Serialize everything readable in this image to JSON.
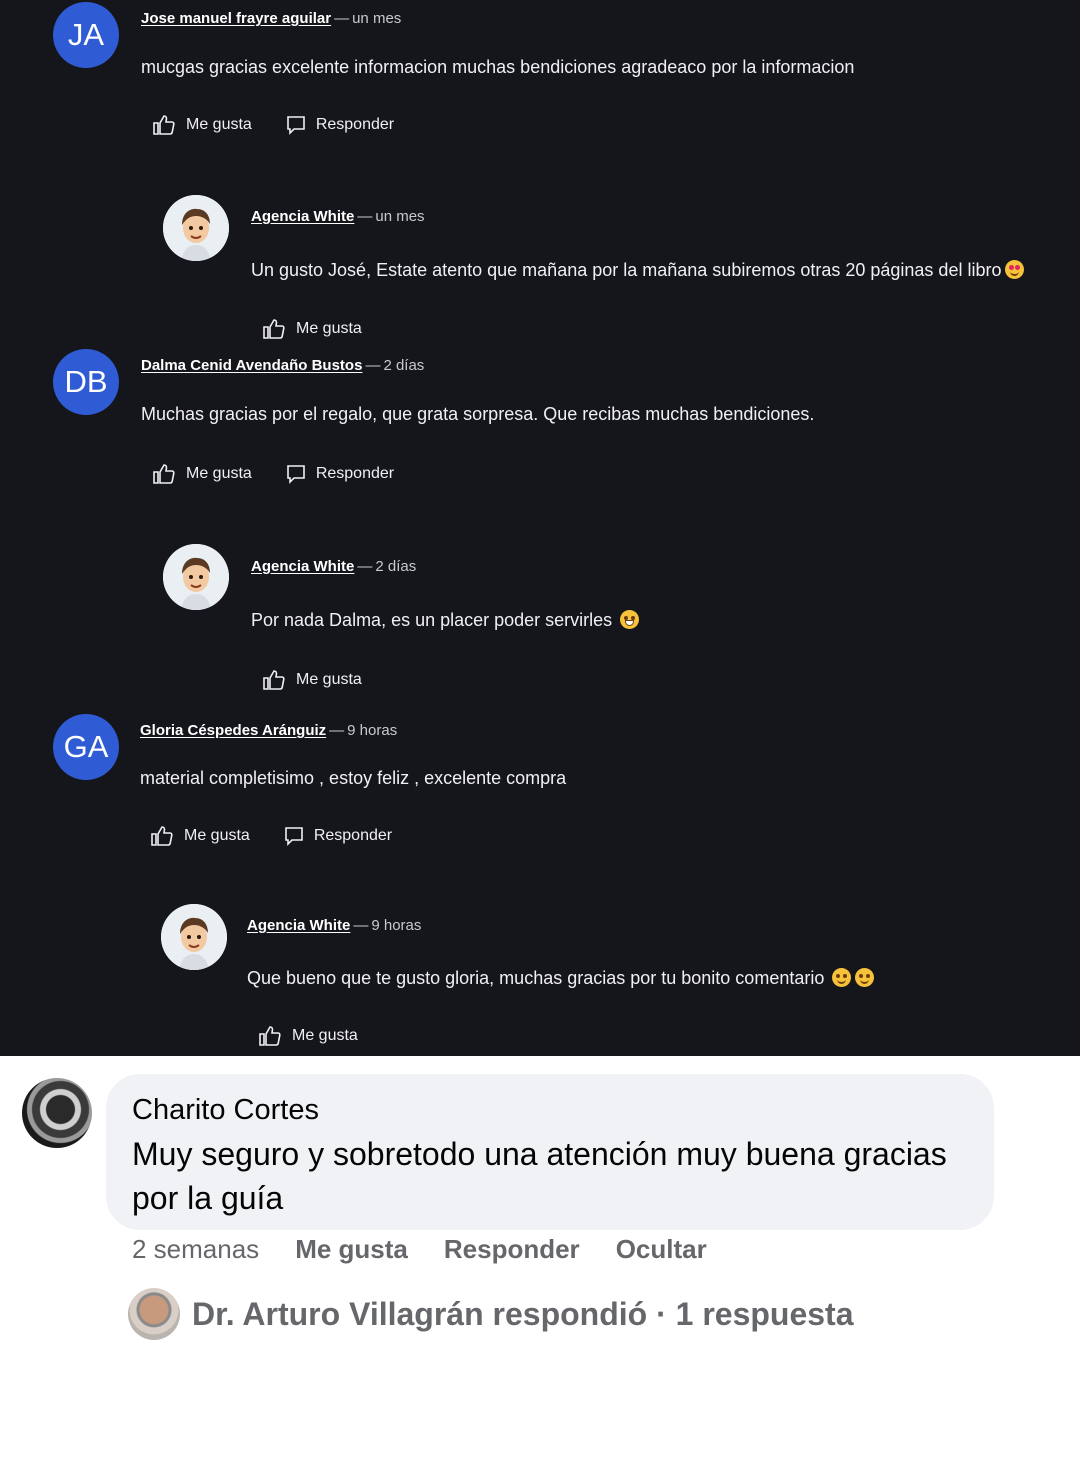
{
  "comments": [
    {
      "initials": "JA",
      "author": "Jose manuel frayre aguilar",
      "time": "un mes",
      "text": "mucgas gracias excelente informacion muchas bendiciones  agradeaco por la informacion",
      "like_label": "Me gusta",
      "reply_label": "Responder",
      "reply": {
        "author": "Agencia White",
        "time": "un mes",
        "text": "Un gusto José, Estate atento que mañana por la mañana subiremos otras 20 páginas del libro",
        "like_label": "Me gusta"
      }
    },
    {
      "initials": "DB",
      "author": "Dalma Cenid Avendaño Bustos",
      "time": "2 días",
      "text": "Muchas gracias por el regalo, que grata sorpresa. Que recibas muchas bendiciones.",
      "like_label": "Me gusta",
      "reply_label": "Responder",
      "reply": {
        "author": "Agencia White",
        "time": "2 días",
        "text": "Por nada Dalma, es un placer poder servirles",
        "like_label": "Me gusta"
      }
    },
    {
      "initials": "GA",
      "author": "Gloria Céspedes Aránguiz",
      "time": "9 horas",
      "text": "material completisimo , estoy feliz , excelente compra",
      "like_label": "Me gusta",
      "reply_label": "Responder",
      "reply": {
        "author": "Agencia White",
        "time": "9 horas",
        "text": "Que bueno que te gusto gloria, muchas gracias por tu bonito comentario",
        "like_label": "Me gusta"
      }
    }
  ],
  "separator": "—",
  "facebook_comment": {
    "author": "Charito Cortes",
    "text": "Muy seguro y sobretodo una atención muy buena gracias por la guía",
    "time": "2 semanas",
    "like_label": "Me gusta",
    "reply_label": "Responder",
    "hide_label": "Ocultar",
    "replies_summary": "Dr. Arturo Villagrán respondió · 1 respuesta"
  },
  "colors": {
    "dark_bg": "#15161b",
    "avatar_blue": "#2f5bd4",
    "fb_bubble": "#f0f2f5",
    "fb_secondary_text": "#65676b"
  }
}
